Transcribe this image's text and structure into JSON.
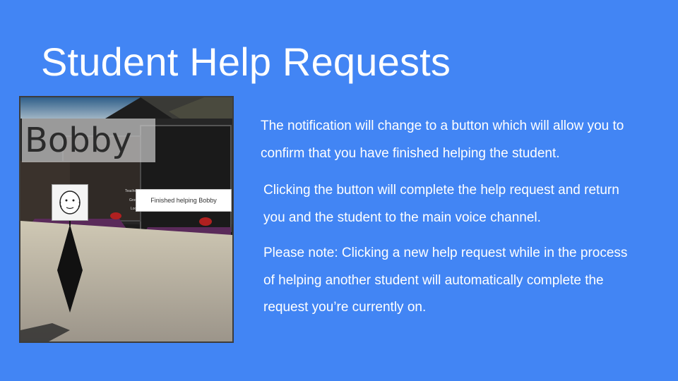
{
  "slide": {
    "title": "Student Help Requests",
    "paragraphs": [
      "The notification will change to a button which will allow you to confirm that you have finished helping the student.",
      "Clicking the button will complete the help request and return you and the student to the main voice channel.",
      "Please note: Clicking a new help request while in the process of helping another student will automatically complete the request you’re currently on."
    ]
  },
  "screenshot": {
    "name_label": "Bobby",
    "finish_button_label": "Finished helping Bobby",
    "sign_text_1": "Teacher Ca",
    "sign_text_2": "Grou",
    "sign_text_3": "Lock"
  },
  "colors": {
    "background": "#4285f4",
    "text": "#ffffff"
  }
}
